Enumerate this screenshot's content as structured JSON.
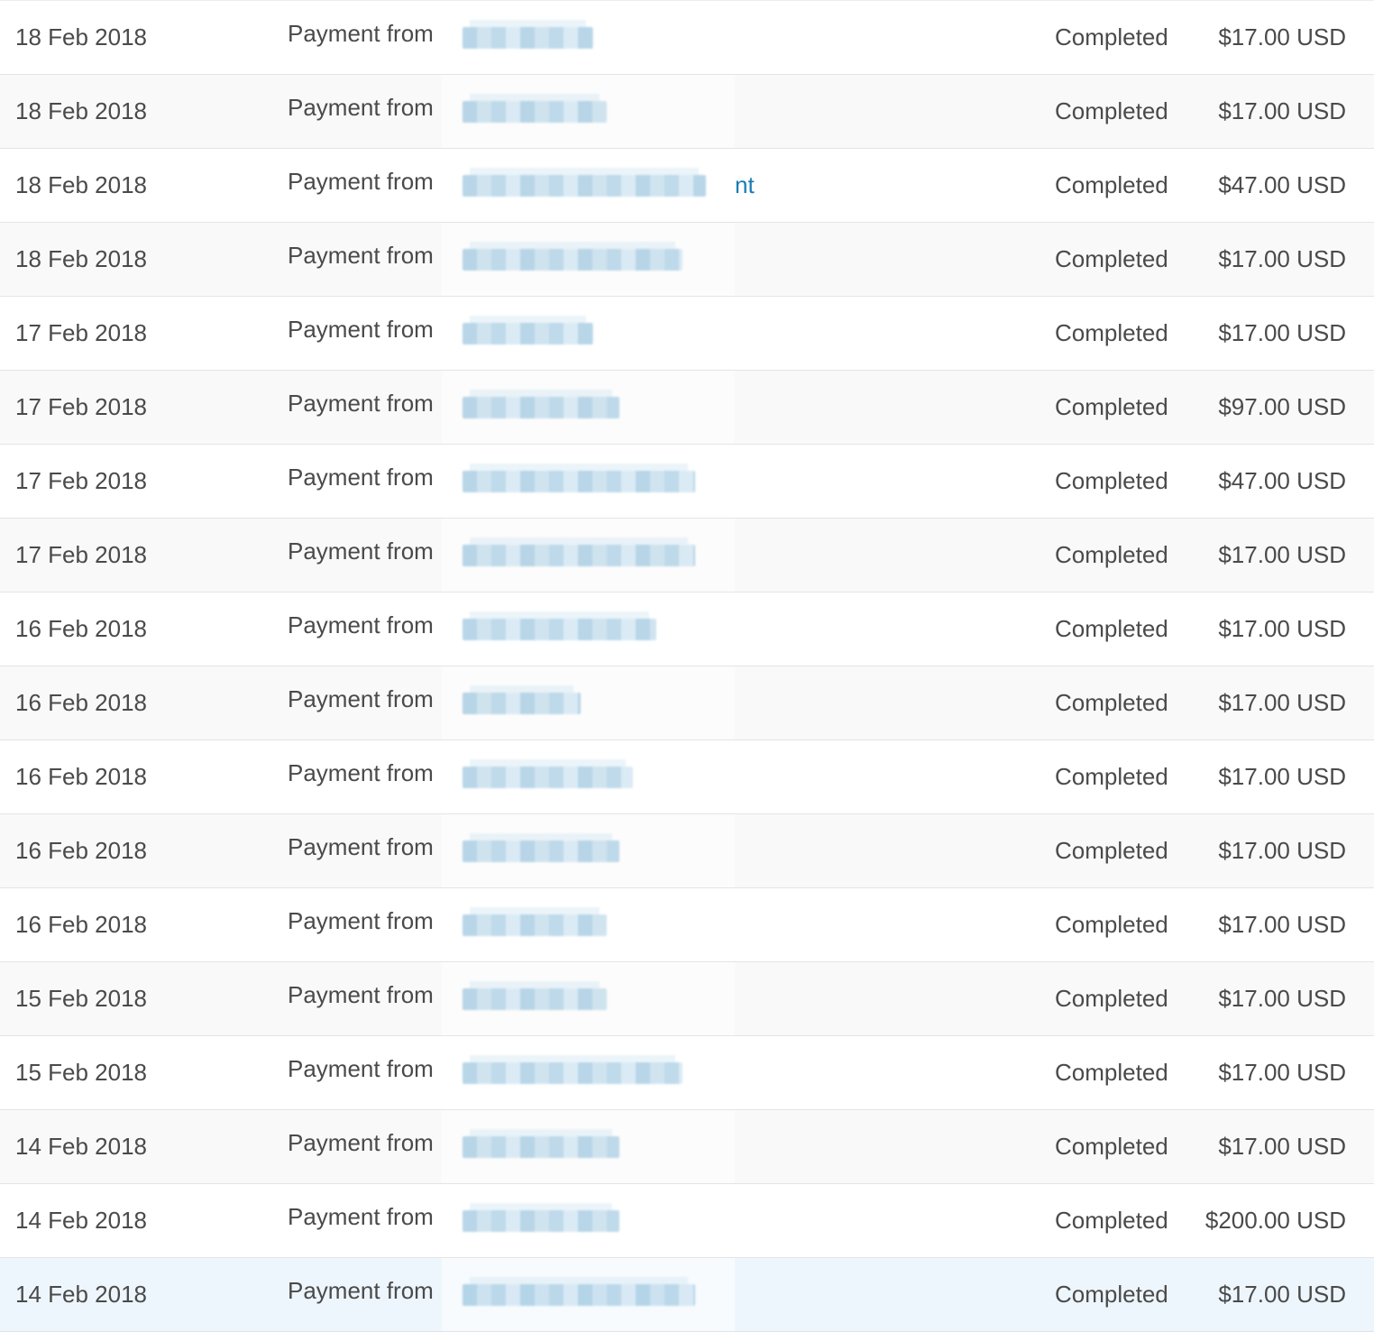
{
  "transactions": [
    {
      "date": "18 Feb 2018",
      "description": "Payment from",
      "link_tail": "",
      "name_redaction_fraction": 0.5,
      "status": "Completed",
      "amount": "$17.00 USD"
    },
    {
      "date": "18 Feb 2018",
      "description": "Payment from",
      "link_tail": "",
      "name_redaction_fraction": 0.55,
      "status": "Completed",
      "amount": "$17.00 USD"
    },
    {
      "date": "18 Feb 2018",
      "description": "Payment from",
      "link_tail": "nt",
      "name_redaction_fraction": 0.93,
      "status": "Completed",
      "amount": "$47.00 USD"
    },
    {
      "date": "18 Feb 2018",
      "description": "Payment from",
      "link_tail": "",
      "name_redaction_fraction": 0.84,
      "status": "Completed",
      "amount": "$17.00 USD"
    },
    {
      "date": "17 Feb 2018",
      "description": "Payment from",
      "link_tail": "",
      "name_redaction_fraction": 0.5,
      "status": "Completed",
      "amount": "$17.00 USD"
    },
    {
      "date": "17 Feb 2018",
      "description": "Payment from",
      "link_tail": "",
      "name_redaction_fraction": 0.6,
      "status": "Completed",
      "amount": "$97.00 USD"
    },
    {
      "date": "17 Feb 2018",
      "description": "Payment from",
      "link_tail": "",
      "name_redaction_fraction": 0.89,
      "status": "Completed",
      "amount": "$47.00 USD"
    },
    {
      "date": "17 Feb 2018",
      "description": "Payment from",
      "link_tail": "",
      "name_redaction_fraction": 0.89,
      "status": "Completed",
      "amount": "$17.00 USD"
    },
    {
      "date": "16 Feb 2018",
      "description": "Payment from",
      "link_tail": "",
      "name_redaction_fraction": 0.74,
      "status": "Completed",
      "amount": "$17.00 USD"
    },
    {
      "date": "16 Feb 2018",
      "description": "Payment from",
      "link_tail": "",
      "name_redaction_fraction": 0.45,
      "status": "Completed",
      "amount": "$17.00 USD"
    },
    {
      "date": "16 Feb 2018",
      "description": "Payment from",
      "link_tail": "",
      "name_redaction_fraction": 0.65,
      "status": "Completed",
      "amount": "$17.00 USD"
    },
    {
      "date": "16 Feb 2018",
      "description": "Payment from",
      "link_tail": "",
      "name_redaction_fraction": 0.6,
      "status": "Completed",
      "amount": "$17.00 USD"
    },
    {
      "date": "16 Feb 2018",
      "description": "Payment from",
      "link_tail": "",
      "name_redaction_fraction": 0.55,
      "status": "Completed",
      "amount": "$17.00 USD"
    },
    {
      "date": "15 Feb 2018",
      "description": "Payment from",
      "link_tail": "",
      "name_redaction_fraction": 0.55,
      "status": "Completed",
      "amount": "$17.00 USD"
    },
    {
      "date": "15 Feb 2018",
      "description": "Payment from",
      "link_tail": "",
      "name_redaction_fraction": 0.84,
      "status": "Completed",
      "amount": "$17.00 USD"
    },
    {
      "date": "14 Feb 2018",
      "description": "Payment from",
      "link_tail": "",
      "name_redaction_fraction": 0.6,
      "status": "Completed",
      "amount": "$17.00 USD"
    },
    {
      "date": "14 Feb 2018",
      "description": "Payment from",
      "link_tail": "",
      "name_redaction_fraction": 0.6,
      "status": "Completed",
      "amount": "$200.00 USD"
    },
    {
      "date": "14 Feb 2018",
      "description": "Payment from",
      "link_tail": "",
      "name_redaction_fraction": 0.89,
      "status": "Completed",
      "amount": "$17.00 USD"
    }
  ],
  "colors": {
    "text": "#4a4a4a",
    "link": "#1a7bb4",
    "row_alt": "#f9f9f9",
    "row_highlight": "#eef6fd",
    "divider": "#e4e4e4"
  }
}
